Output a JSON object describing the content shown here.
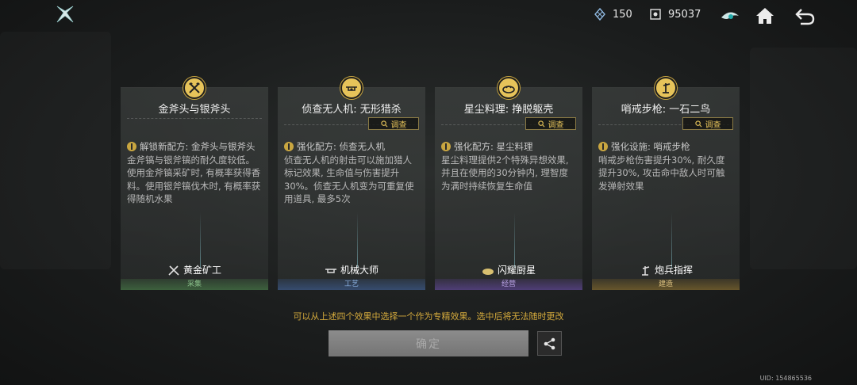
{
  "topbar": {
    "resource1_value": "150",
    "resource2_value": "95037"
  },
  "cards": [
    {
      "title": "金斧头与银斧头",
      "effect_text": "解锁新配方: 金斧头与银斧头",
      "effect_desc": "金斧镐与银斧镐的耐久度较低。使用金斧镐采矿时, 有概率获得香料。使用银斧镐伐木时, 有概率获得随机水果",
      "skill": "黄金矿工",
      "category": "采集"
    },
    {
      "title": "侦查无人机: 无形猎杀",
      "inspect_label": "调查",
      "effect_text": "强化配方: 侦查无人机",
      "effect_desc": "侦查无人机的射击可以施加猎人标记效果, 生命值与伤害提升30%。侦查无人机变为可重复使用道具, 最多5次",
      "skill": "机械大师",
      "category": "工艺"
    },
    {
      "title": "星尘料理: 挣脱躯壳",
      "inspect_label": "调查",
      "effect_text": "强化配方: 星尘料理",
      "effect_desc": "星尘料理提供2个特殊异想效果, 并且在使用的30分钟内, 理智度为满时持续恢复生命值",
      "skill": "闪耀厨星",
      "category": "经营"
    },
    {
      "title": "哨戒步枪: 一石二鸟",
      "inspect_label": "调查",
      "effect_text": "强化设施: 哨戒步枪",
      "effect_desc": "哨戒步枪伤害提升30%, 耐久度提升30%, 攻击命中敌人时可触发弹射效果",
      "skill": "炮兵指挥",
      "category": "建造"
    }
  ],
  "hint": "可以从上述四个效果中选择一个作为专精效果。选中后将无法随时更改",
  "confirm_label": "确定",
  "uid": "UID: 154865536",
  "colors": {
    "accent_gold": "#e6c35a",
    "hint": "#d4aa3c",
    "category_green": "#8cc48c",
    "category_blue": "#8eb4e6",
    "category_purple": "#b9a2e6",
    "category_gold": "#e0c480"
  }
}
